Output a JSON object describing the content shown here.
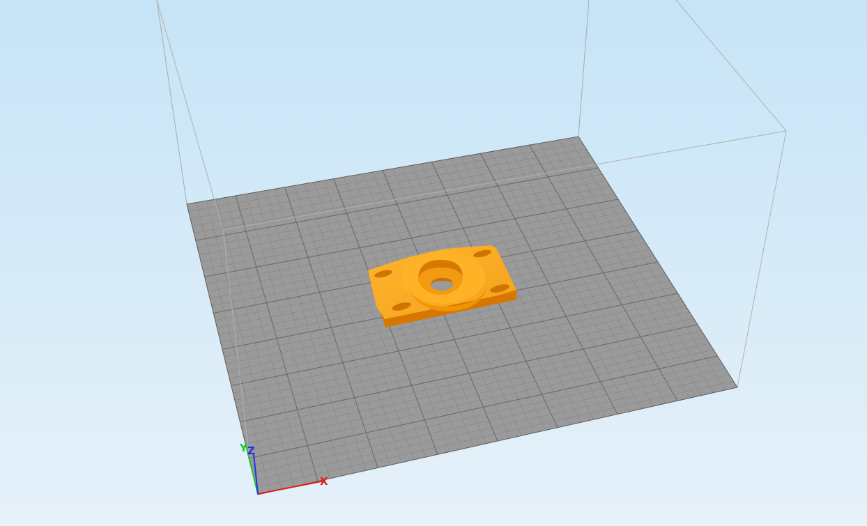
{
  "viewport": {
    "background_top_color": "#c6e4f7",
    "background_bottom_color": "#e6f1f9"
  },
  "build_plate": {
    "fill_color": "#9a9a9a",
    "grid_minor_color": "#858585",
    "grid_major_color": "#6a6a6a",
    "minor_divisions": 40,
    "major_every": 5
  },
  "build_volume": {
    "edge_color": "#a9a9a9"
  },
  "model": {
    "color": "#ffab1f",
    "dark_color": "#e08000",
    "shadow_color": "#c86f00"
  },
  "axes": {
    "x_label": "X",
    "y_label": "Y",
    "z_label": "Z",
    "x_color": "#e0201c",
    "y_color": "#18c830",
    "z_color": "#2430e8"
  }
}
